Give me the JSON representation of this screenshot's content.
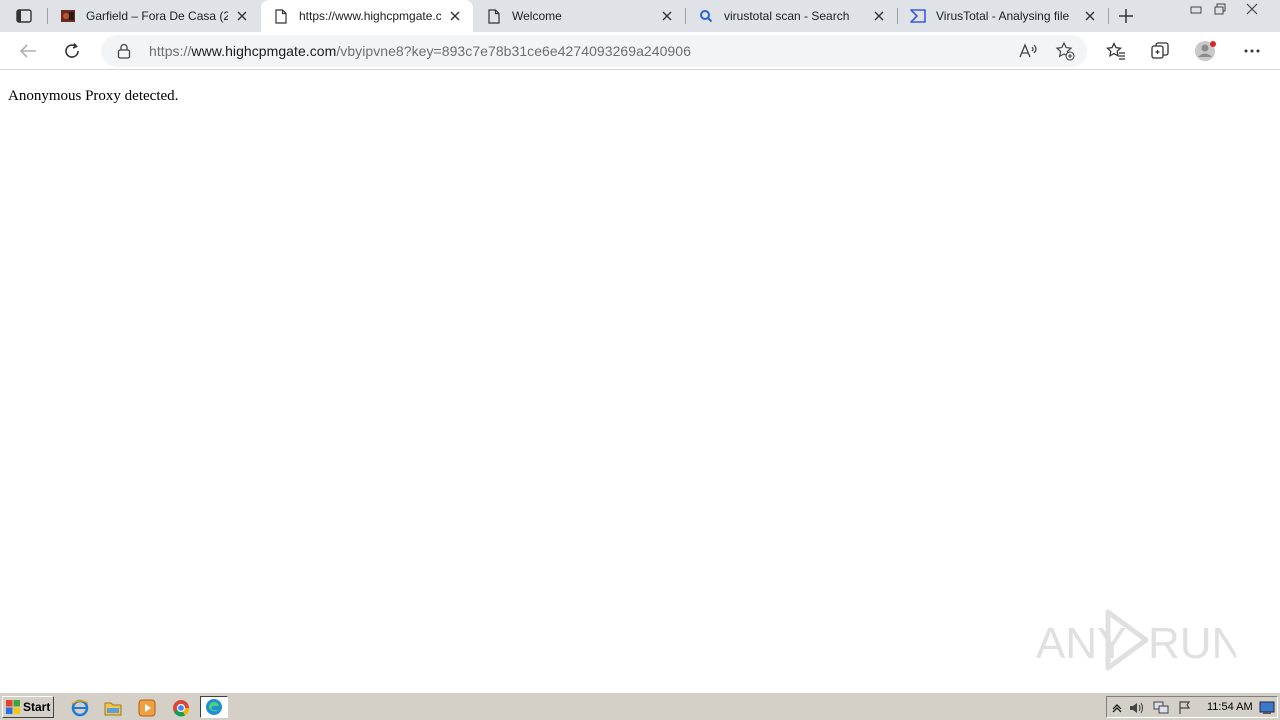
{
  "browser": {
    "tabs": [
      {
        "title": "Garfield – Fora De Casa (202",
        "favicon": "garfield-image-icon",
        "active": false
      },
      {
        "title": "https://www.highcpmgate.c",
        "favicon": "page-icon",
        "active": true
      },
      {
        "title": "Welcome",
        "favicon": "page-icon",
        "active": false
      },
      {
        "title": "virustotal scan - Search",
        "favicon": "search-icon",
        "active": false
      },
      {
        "title": "VirusTotal - Analysing file",
        "favicon": "virustotal-icon",
        "active": false
      }
    ],
    "address_bar": {
      "scheme": "https://",
      "host": "www.highcpmgate.com",
      "path": "/vbyipvne8?key=893c7e78b31ce6e4274093269a240906"
    },
    "toolbar_icons": [
      "back-icon",
      "refresh-icon",
      "lock-icon",
      "read-aloud-icon",
      "add-favorite-icon",
      "favorites-icon",
      "collections-icon",
      "profile-icon",
      "more-icon"
    ]
  },
  "page": {
    "message": "Anonymous Proxy detected."
  },
  "watermark": {
    "text_left": "ANY",
    "text_right": "RUN"
  },
  "taskbar": {
    "start_label": "Start",
    "clock": "11:54 AM",
    "quick_launch": [
      "ie-icon",
      "explorer-icon",
      "media-player-icon",
      "chrome-icon",
      "edge-icon"
    ]
  },
  "colors": {
    "tabstrip_bg": "#dfe2e6",
    "omnibox_bg": "#f3f4f6",
    "taskbar_bg": "#d4d0c8"
  }
}
